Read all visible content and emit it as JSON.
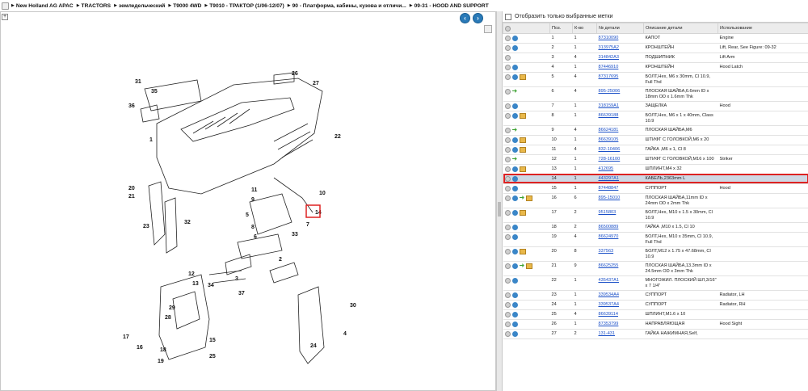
{
  "breadcrumb": {
    "items": [
      "New Holland AG APAC",
      "TRACTORS",
      "земледельческий",
      "T9000 4WD",
      "T9010 - ТРАКТОР (1/06-12/07)",
      "90 - Платформа, кабины, кузова и отличи...",
      "09-31 - HOOD AND SUPPORT"
    ]
  },
  "left": {
    "expand_label": "+",
    "prev_label": "‹",
    "next_label": "›"
  },
  "diagram": {
    "callouts": [
      "31",
      "26",
      "27",
      "36",
      "1",
      "22",
      "35",
      "11",
      "9",
      "10",
      "5",
      "14",
      "6",
      "7",
      "20",
      "21",
      "23",
      "32",
      "8",
      "33",
      "12",
      "34",
      "3",
      "37",
      "2",
      "13",
      "29",
      "28",
      "18",
      "15",
      "30",
      "17",
      "16",
      "25",
      "19",
      "24",
      "4"
    ]
  },
  "filter": {
    "label": "Отобразить только выбранные метки"
  },
  "table": {
    "headers": [
      "",
      "Поз.",
      "К-во",
      "№ детали",
      "Описание детали",
      "Использование"
    ],
    "rows": [
      {
        "pos": "1",
        "qty": "1",
        "code": "87310090",
        "desc": "КАПОТ",
        "use": "Engine",
        "icons": "gb"
      },
      {
        "pos": "2",
        "qty": "1",
        "code": "313975A2",
        "desc": "КРОНШТЕЙН",
        "use": "Lift, Rear, See Figure: 09-32",
        "icons": "gb"
      },
      {
        "pos": "3",
        "qty": "4",
        "code": "314842A3",
        "desc": "ПОДШИПНИК",
        "use": "Lift Arm",
        "icons": "g"
      },
      {
        "pos": "4",
        "qty": "1",
        "code": "87446910",
        "desc": "КРОНШТЕЙН",
        "use": "Hood Latch",
        "icons": "gb"
      },
      {
        "pos": "5",
        "qty": "4",
        "code": "87317695",
        "desc": "БОЛТ,Hex, M6 x 30mm, Cl 10.9, Full Thd",
        "use": "",
        "icons": "gbx"
      },
      {
        "pos": "6",
        "qty": "4",
        "code": "895-25006",
        "desc": "ПЛОСКАЯ ШАЙБА,6.6mm ID x 18mm OD x 1.6mm Thk",
        "use": "",
        "icons": "gr"
      },
      {
        "pos": "7",
        "qty": "1",
        "code": "318159A1",
        "desc": "ЗАЩЕЛКА",
        "use": "Hood",
        "icons": "gb"
      },
      {
        "pos": "8",
        "qty": "1",
        "code": "86639188",
        "desc": "БОЛТ,Hex, M6 x 1 x 40mm, Class 10.9",
        "use": "",
        "icons": "gbx"
      },
      {
        "pos": "9",
        "qty": "4",
        "code": "86624181",
        "desc": "ПЛОСКАЯ ШАЙБА,M6",
        "use": "",
        "icons": "gr"
      },
      {
        "pos": "10",
        "qty": "1",
        "code": "86639105",
        "desc": "ШТИФТ С ГОЛОВКОЙ,M6 x 20",
        "use": "",
        "icons": "gbx"
      },
      {
        "pos": "11",
        "qty": "4",
        "code": "832-10406",
        "desc": "ГАЙКА ,M6 x 1, Cl 8",
        "use": "",
        "icons": "gbx"
      },
      {
        "pos": "12",
        "qty": "1",
        "code": "728-16100",
        "desc": "ШТИФТ С ГОЛОВКОЙ,M16 x 100",
        "use": "Striker",
        "icons": "gr"
      },
      {
        "pos": "13",
        "qty": "1",
        "code": "412695",
        "desc": "ШПЛИНТ,M4 x 32",
        "use": "",
        "icons": "gbx"
      },
      {
        "pos": "14",
        "qty": "1",
        "code": "443297A1",
        "desc": "КАБЕЛЬ,2363mm L",
        "use": "",
        "icons": "gb",
        "selected": true
      },
      {
        "pos": "15",
        "qty": "1",
        "code": "87448847",
        "desc": "СУППОРТ",
        "use": "Hood",
        "icons": "gb"
      },
      {
        "pos": "16",
        "qty": "6",
        "code": "895-15010",
        "desc": "ПЛОСКАЯ ШАЙБА,11mm ID x 24mm OD x 2mm Thk",
        "use": "",
        "icons": "gbrx"
      },
      {
        "pos": "17",
        "qty": "2",
        "code": "9515803",
        "desc": "БОЛТ,Hex, M10 x 1.5 x 30mm, Cl 10.9",
        "use": "",
        "icons": "gbx"
      },
      {
        "pos": "18",
        "qty": "2",
        "code": "86500889",
        "desc": "ГАЙКА ,M10 x 1.5, Cl 10",
        "use": "",
        "icons": "gb"
      },
      {
        "pos": "19",
        "qty": "4",
        "code": "86624970",
        "desc": "БОЛТ,Hex, M10 x 35mm, Cl 10.9, Full Thd",
        "use": "",
        "icons": "gb"
      },
      {
        "pos": "20",
        "qty": "8",
        "code": "337563",
        "desc": "БОЛТ,M12 x 1.75 x 47.68mm, Cl 10.9",
        "use": "",
        "icons": "gbx"
      },
      {
        "pos": "21",
        "qty": "9",
        "code": "86625255",
        "desc": "ПЛОСКАЯ ШАЙБА,13.3mm ID x 24.5mm OD x 3mm Thk",
        "use": "",
        "icons": "gbrx"
      },
      {
        "pos": "22",
        "qty": "1",
        "code": "435437A1",
        "desc": "МНОГОЖИЛ. ПЛОСКИЙ ШЛ,3/16\" x 7 1/4\"",
        "use": "",
        "icons": "gb"
      },
      {
        "pos": "23",
        "qty": "1",
        "code": "339534A4",
        "desc": "СУППОРТ",
        "use": "Radiator, LH",
        "icons": "gb"
      },
      {
        "pos": "24",
        "qty": "1",
        "code": "339537A4",
        "desc": "СУППОРТ",
        "use": "Radiator, RH",
        "icons": "gb"
      },
      {
        "pos": "25",
        "qty": "4",
        "code": "86639114",
        "desc": "ШПЛИНТ,M1.6 x 10",
        "use": "",
        "icons": "gb"
      },
      {
        "pos": "26",
        "qty": "1",
        "code": "87353799",
        "desc": "НАПРАВЛЯЮЩАЯ",
        "use": "Hood Sight",
        "icons": "gb"
      },
      {
        "pos": "27",
        "qty": "2",
        "code": "131-431",
        "desc": "ГАЙКА НАЖИМНАЯ,Self,",
        "use": "",
        "icons": "gb"
      }
    ]
  }
}
